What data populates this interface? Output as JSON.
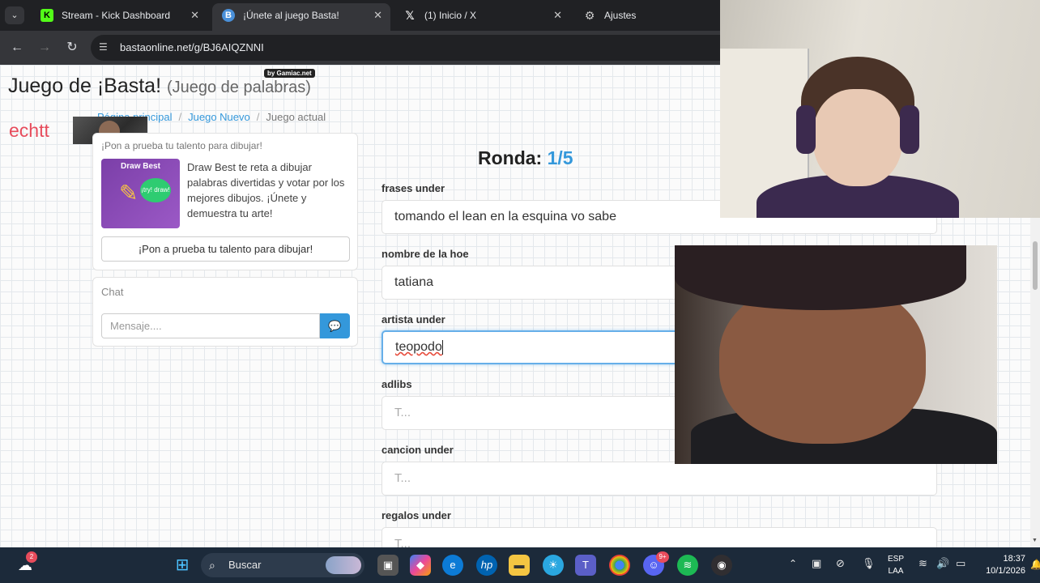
{
  "browser": {
    "tabs": [
      {
        "title": "Stream - Kick Dashboard",
        "icon": "kick-icon",
        "close": "✕"
      },
      {
        "title": "¡Únete al juego Basta!",
        "icon": "basta-icon",
        "close": "✕"
      },
      {
        "title": "(1) Inicio / X",
        "icon": "x-icon",
        "close": "✕"
      },
      {
        "title": "Ajustes",
        "icon": "settings-icon"
      }
    ],
    "url": "bastaonline.net/g/BJ6AIQZNNI"
  },
  "site": {
    "title": "Juego de ¡Basta!",
    "subtitle": "(Juego de palabras)",
    "badge": "by Gamiac.net",
    "player": "echtt"
  },
  "breadcrumb": {
    "items": [
      "Página principal",
      "Juego Nuevo"
    ],
    "current": "Juego actual"
  },
  "promo": {
    "header": "¡Pon a prueba tu talento para dibujar!",
    "image_title": "Draw Best",
    "image_bubble": "¡try! draw!",
    "text": "Draw Best te reta a dibujar palabras divertidas y votar por los mejores dibujos. ¡Únete y demuestra tu arte!",
    "button": "¡Pon a prueba tu talento para dibujar!"
  },
  "chat": {
    "title": "Chat",
    "placeholder": "Mensaje...."
  },
  "game": {
    "round_label": "Ronda:",
    "round_value": "1/5",
    "fields": [
      {
        "label": "frases under",
        "value": "tomando el lean en la esquina vo sabe",
        "placeholder": ""
      },
      {
        "label": "nombre de la hoe",
        "value": "tatiana",
        "placeholder": ""
      },
      {
        "label": "artista under",
        "value": "teopodo",
        "placeholder": ""
      },
      {
        "label": "adlibs",
        "value": "",
        "placeholder": "T..."
      },
      {
        "label": "cancion under",
        "value": "",
        "placeholder": "T..."
      },
      {
        "label": "regalos under",
        "value": "",
        "placeholder": "T..."
      }
    ]
  },
  "taskbar": {
    "search_label": "Buscar",
    "language": "ESP",
    "language_sub": "LAA",
    "time": "18:37",
    "date": "10/1/2026",
    "weather_badge": "2",
    "discord_badge": "9+"
  }
}
